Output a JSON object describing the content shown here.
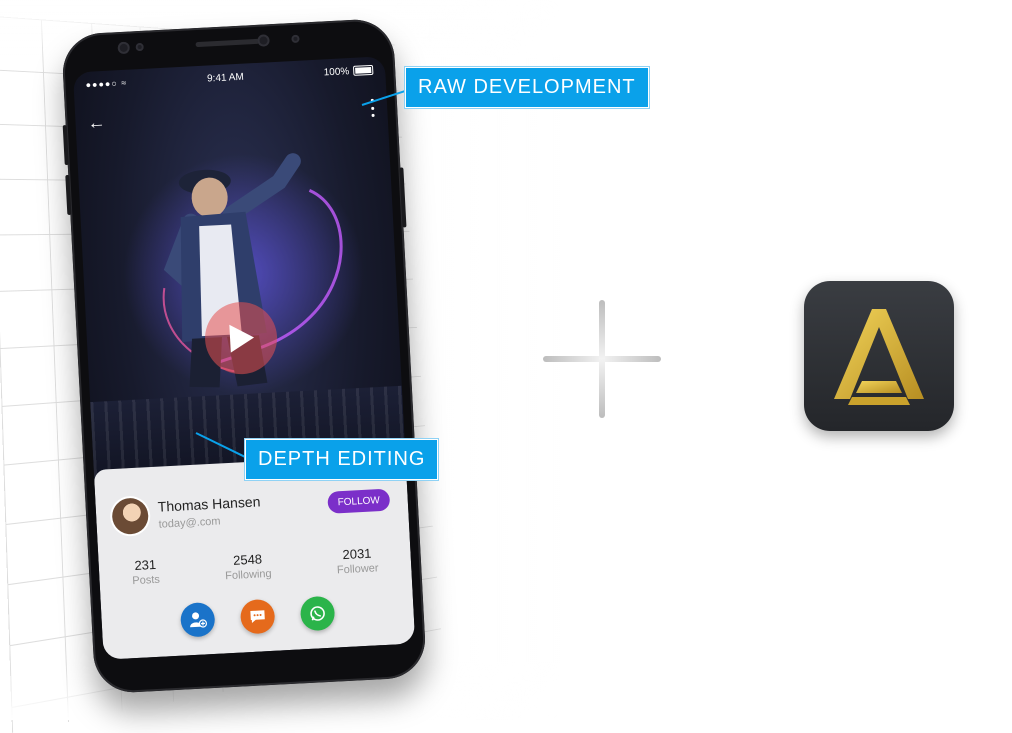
{
  "phone": {
    "status_time": "9:41 AM",
    "battery_percent": "100%",
    "profile": {
      "name": "Thomas Hansen",
      "email": "today@.com",
      "follow_label": "FOLLOW",
      "stats": [
        {
          "value": "231",
          "label": "Posts"
        },
        {
          "value": "2548",
          "label": "Following"
        },
        {
          "value": "2031",
          "label": "Follower"
        }
      ],
      "actions": [
        {
          "icon": "add-user-icon",
          "color": "#1a73c9"
        },
        {
          "icon": "chat-icon",
          "color": "#e56a1c"
        },
        {
          "icon": "whatsapp-icon",
          "color": "#2bb44a"
        }
      ]
    }
  },
  "callouts": {
    "raw": "RAW DEVELOPMENT",
    "depth": "DEPTH EDITING"
  },
  "colors": {
    "callout": "#0aa1ea",
    "follow": "#7b2fc9",
    "logo_gold": "#d9b43a"
  },
  "logo": {
    "icon": "app-logo-icon"
  }
}
